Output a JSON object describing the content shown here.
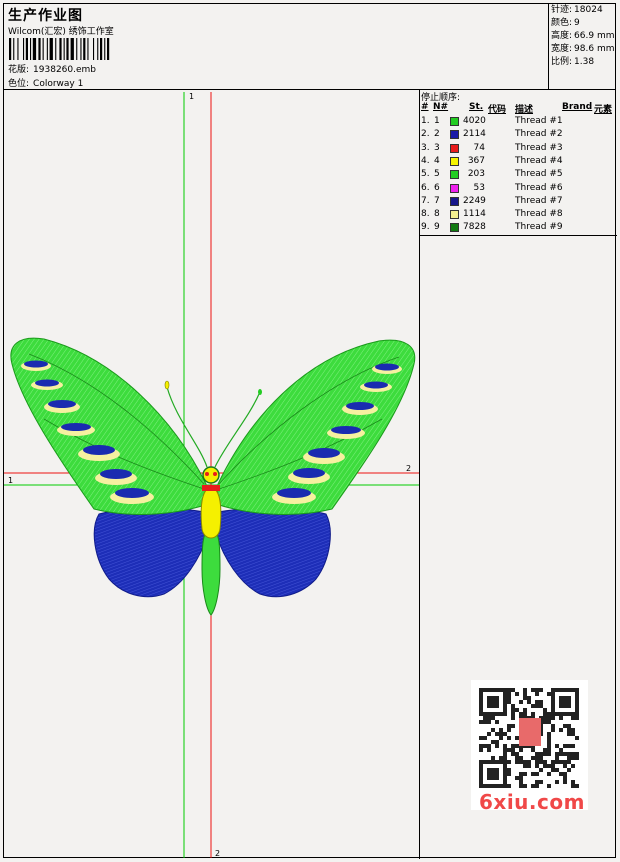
{
  "header": {
    "title": "生产作业图",
    "company": "Wilcom(汇宏) 绣饰工作室",
    "design_label": "花版:",
    "design_value": "1938260.emb",
    "colorway_label": "色位:",
    "colorway_value": "Colorway 1"
  },
  "stats": [
    {
      "label": "针迹:",
      "value": "18024"
    },
    {
      "label": "颜色:",
      "value": "9"
    },
    {
      "label": "高度:",
      "value": "66.9 mm"
    },
    {
      "label": "宽度:",
      "value": "98.6 mm"
    },
    {
      "label": "比例:",
      "value": "1.38"
    }
  ],
  "stop_sequence": {
    "title": "停止顺序:",
    "headers": {
      "hash": "#",
      "num": "N#",
      "st": "St.",
      "code": "代码",
      "desc": "描述",
      "brand": "Brand",
      "elem": "元素"
    },
    "rows": [
      {
        "idx": "1.",
        "n": "1",
        "color": "#22cc22",
        "st": "4020",
        "desc": "Thread #1"
      },
      {
        "idx": "2.",
        "n": "2",
        "color": "#1a1aa8",
        "st": "2114",
        "desc": "Thread #2"
      },
      {
        "idx": "3.",
        "n": "3",
        "color": "#e81c1c",
        "st": "74",
        "desc": "Thread #3"
      },
      {
        "idx": "4.",
        "n": "4",
        "color": "#f5f500",
        "st": "367",
        "desc": "Thread #4"
      },
      {
        "idx": "5.",
        "n": "5",
        "color": "#22cc22",
        "st": "203",
        "desc": "Thread #5"
      },
      {
        "idx": "6.",
        "n": "6",
        "color": "#ee22ee",
        "st": "53",
        "desc": "Thread #6"
      },
      {
        "idx": "7.",
        "n": "7",
        "color": "#16168a",
        "st": "2249",
        "desc": "Thread #7"
      },
      {
        "idx": "8.",
        "n": "8",
        "color": "#f4f090",
        "st": "1114",
        "desc": "Thread #8"
      },
      {
        "idx": "9.",
        "n": "9",
        "color": "#127a12",
        "st": "7828",
        "desc": "Thread #9"
      }
    ]
  },
  "axes": {
    "v_green": "1",
    "h_green": "1",
    "h_red": "2",
    "v_red": "2"
  },
  "watermark": "6xiu.com",
  "colors": {
    "wing_green": "#33dd33",
    "wing_blue": "#1a2bb0",
    "body_yellow": "#f5f000",
    "spot_cream": "#f6f0a0",
    "axis_green": "#00cc00",
    "axis_red": "#ee1111"
  }
}
